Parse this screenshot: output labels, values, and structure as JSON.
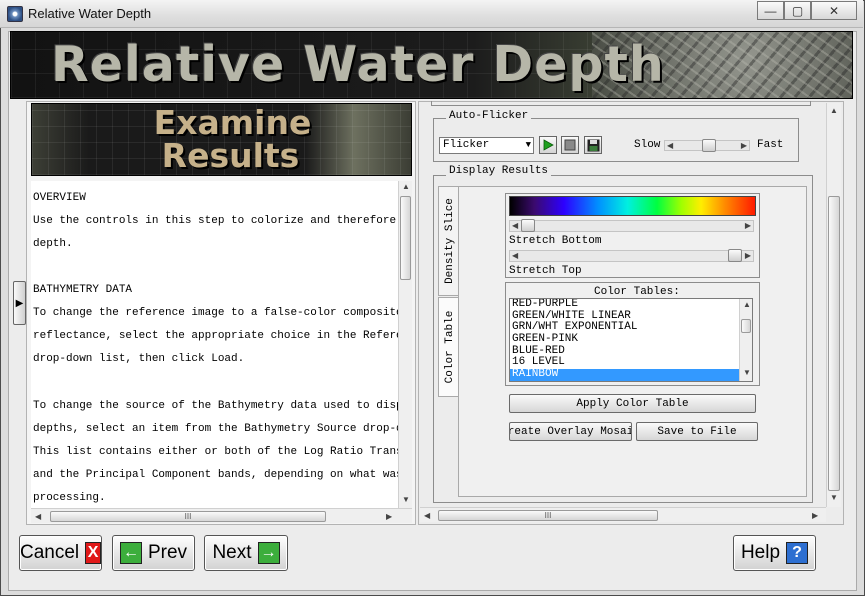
{
  "window": {
    "title": "Relative Water Depth",
    "minimize_glyph": "—",
    "maximize_glyph": "▢",
    "close_glyph": "✕"
  },
  "banner": {
    "title": "Relative Water Depth"
  },
  "step_banner": {
    "line1": "Examine",
    "line2": "Results"
  },
  "help_text": {
    "lines": [
      "OVERVIEW",
      "    Use the controls in this step to colorize and therefore hig",
      "    depth.",
      "",
      "BATHYMETRY DATA",
      "    To change the reference image to a false-color composite or",
      "    reflectance, select the appropriate choice in the Reference",
      "    drop-down list, then click Load.",
      "",
      "    To change the source of the Bathymetry data used to display",
      "    depths, select an item from the Bathymetry Source drop-down",
      "    This list contains either or both of the Log Ratio Transfor",
      "    and the Principal Component bands, depending on what was se",
      "    processing."
    ]
  },
  "auto_flicker": {
    "group_label": "Auto-Flicker",
    "mode_value": "Flicker",
    "slow_label": "Slow",
    "fast_label": "Fast",
    "speed_level": 0.55
  },
  "display_results": {
    "group_label": "Display Results",
    "tabs": [
      "Density Slice",
      "Color Table"
    ],
    "active_tab": "Color Table",
    "stretch_bottom_label": "Stretch Bottom",
    "stretch_top_label": "Stretch Top",
    "stretch_bottom_level": 0.0,
    "stretch_top_level": 1.0,
    "color_tables_label": "Color Tables:",
    "color_tables": [
      "RED-PURPLE",
      "GREEN/WHITE LINEAR",
      "GRN/WHT EXPONENTIAL",
      "GREEN-PINK",
      "BLUE-RED",
      "16 LEVEL",
      "RAINBOW"
    ],
    "selected_color_table": "RAINBOW",
    "apply_button": "Apply Color Table",
    "overlay_button": "Create Overlay Mosaic",
    "save_button": "Save to File"
  },
  "nav": {
    "cancel_label": "Cancel",
    "prev_label": "Prev",
    "next_label": "Next",
    "help_label": "Help",
    "cancel_icon": "X",
    "prev_icon": "←",
    "next_icon": "→",
    "help_icon": "?"
  },
  "scroll": {
    "thumb_glyph": "III"
  },
  "colors": {
    "cancel": "#e01818",
    "nav_arrow": "#3cae3c",
    "help": "#2d6fd1",
    "selection": "#3399ff"
  }
}
